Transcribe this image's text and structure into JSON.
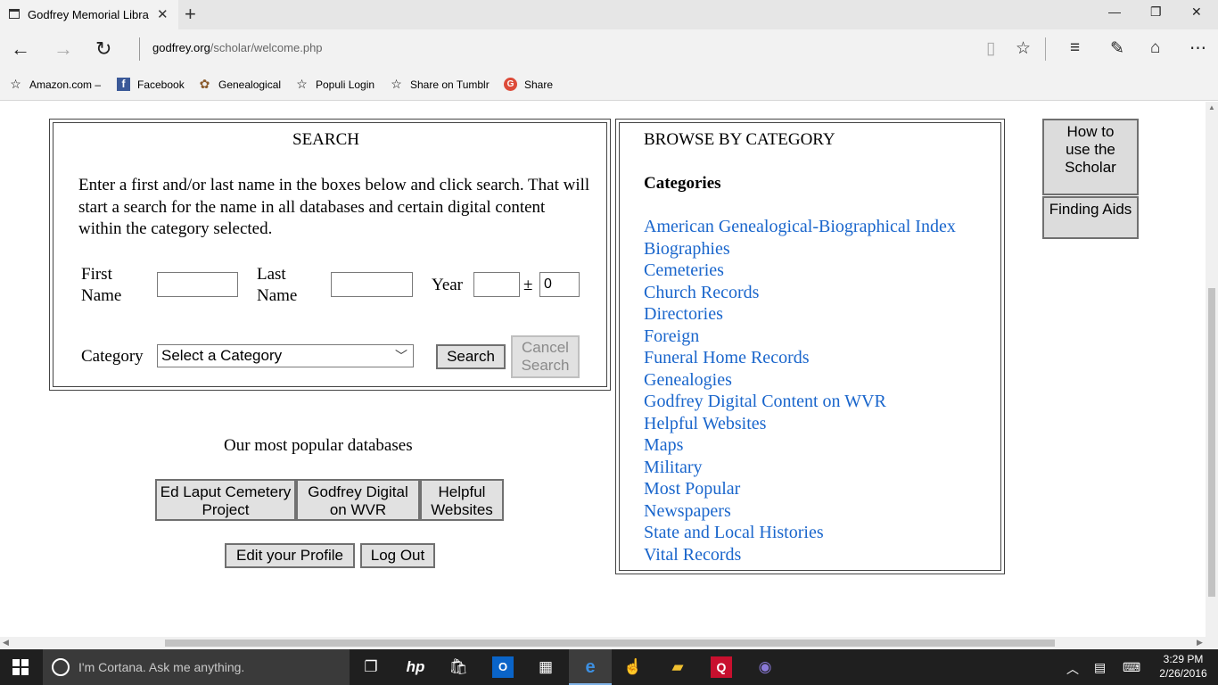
{
  "browser": {
    "tab_title": "Godfrey Memorial Libra",
    "url_host": "godfrey.org",
    "url_path": "/scholar/welcome.php"
  },
  "favorites": [
    {
      "label": "Amazon.com –",
      "icon": "star-icon"
    },
    {
      "label": "Facebook",
      "icon": "facebook-icon"
    },
    {
      "label": "Genealogical",
      "icon": "genealogical-icon"
    },
    {
      "label": "Populi Login",
      "icon": "star-icon"
    },
    {
      "label": "Share on Tumblr",
      "icon": "star-icon"
    },
    {
      "label": "Share",
      "icon": "google-plus-icon"
    }
  ],
  "search": {
    "title": "SEARCH",
    "instructions": "Enter a first and/or last name in the boxes below and click search. That will start a search for the name in all databases and certain digital content within the category selected.",
    "first_name_label": "First Name",
    "last_name_label": "Last Name",
    "year_label": "Year",
    "plus_minus": "±",
    "year_range_value": "0",
    "category_label": "Category",
    "category_selected": "Select a Category",
    "search_button": "Search",
    "cancel_button": "Cancel Search"
  },
  "popular": {
    "heading": "Our most popular databases",
    "buttons": [
      "Ed Laput Cemetery Project",
      "Godfrey Digital on WVR",
      "Helpful Websites"
    ]
  },
  "account": {
    "edit_profile": "Edit your Profile",
    "log_out": "Log Out"
  },
  "browse": {
    "title": "BROWSE BY CATEGORY",
    "heading": "Categories",
    "link_color": "#1a66cc",
    "categories": [
      "American Genealogical-Biographical Index",
      "Biographies",
      "Cemeteries",
      "Church Records",
      "Directories",
      "Foreign",
      "Funeral Home Records",
      "Genealogies",
      "Godfrey Digital Content on WVR",
      "Helpful Websites",
      "Maps",
      "Military",
      "Most Popular",
      "Newspapers",
      "State and Local Histories",
      "Vital Records"
    ]
  },
  "side": {
    "how_to": "How to use the Scholar",
    "finding_aids": "Finding Aids"
  },
  "taskbar": {
    "cortana_placeholder": "I'm Cortana. Ask me anything.",
    "time": "3:29 PM",
    "date": "2/26/2016"
  }
}
